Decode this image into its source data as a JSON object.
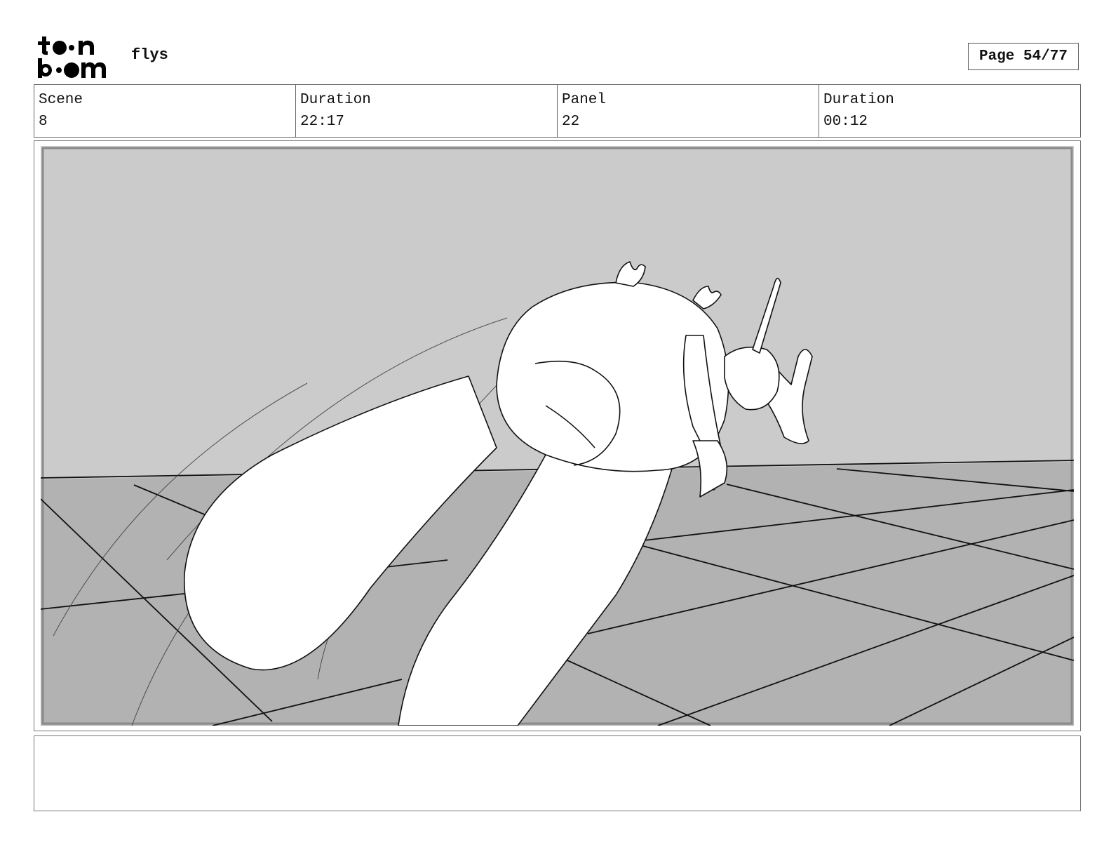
{
  "header": {
    "logo_text": "toon boom",
    "project_title": "flys",
    "page_label": "Page 54/77"
  },
  "info": {
    "scene_label": "Scene",
    "scene_value": "8",
    "scene_duration_label": "Duration",
    "scene_duration_value": "22:17",
    "panel_label": "Panel",
    "panel_value": "22",
    "panel_duration_label": "Duration",
    "panel_duration_value": "00:12"
  },
  "panel": {
    "sky_color": "#cbcbcb",
    "floor_color": "#b2b2b2",
    "figure_color": "#ffffff",
    "line_color": "#111111"
  },
  "notes": {
    "text": ""
  }
}
